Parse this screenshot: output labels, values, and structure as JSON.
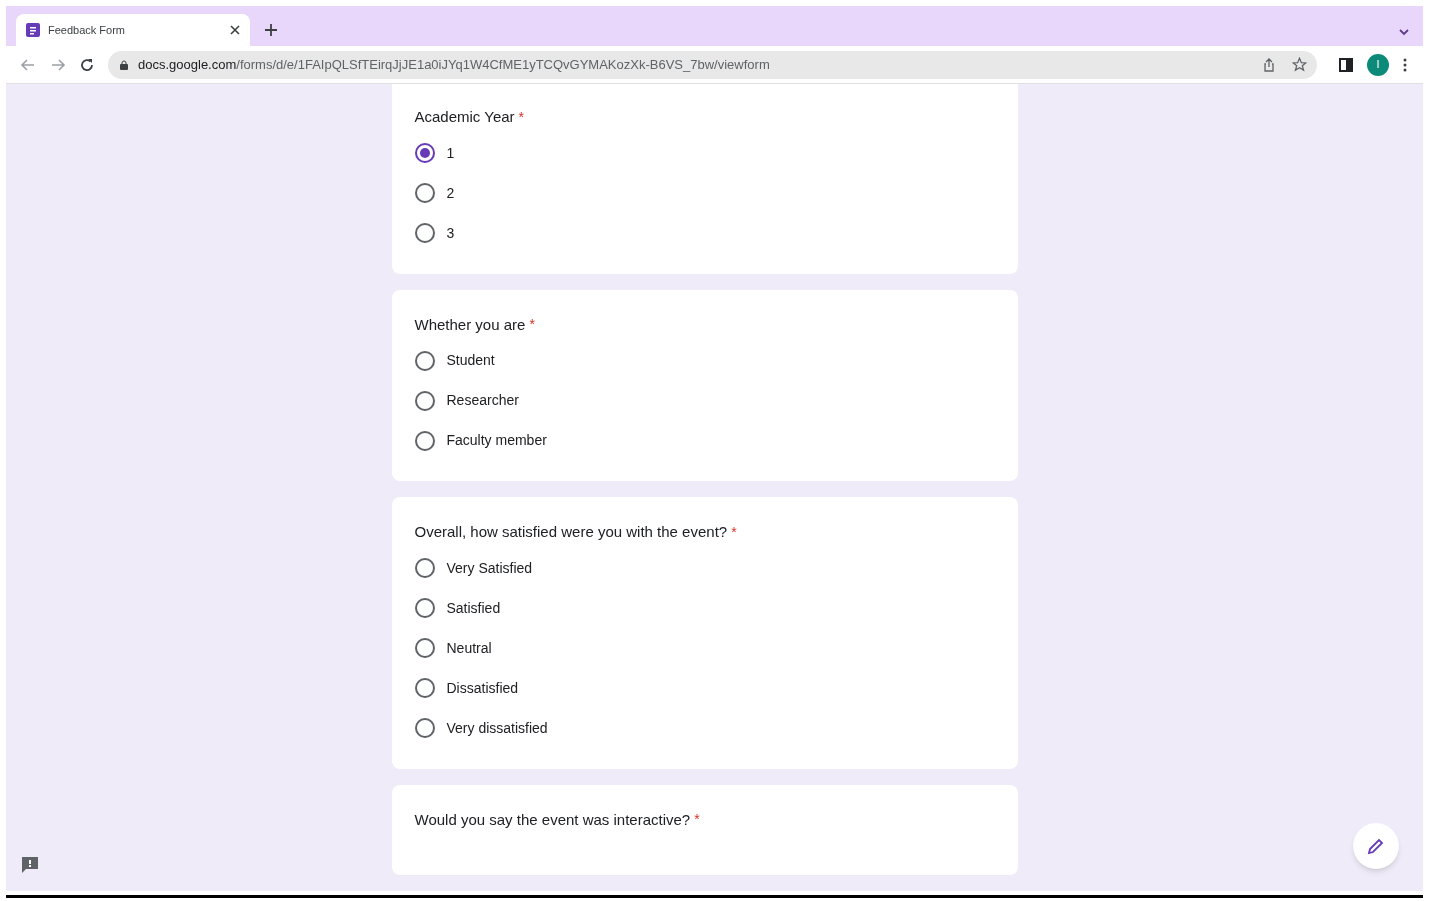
{
  "browser": {
    "tab": {
      "title": "Feedback Form",
      "selected": true
    },
    "url": {
      "domain": "docs.google.com",
      "path": "/forms/d/e/1FAIpQLSfTEirqJjJE1a0iJYq1W4CfME1yTCQvGYMAKozXk-B6VS_7bw/viewform"
    },
    "profile_initial": "I"
  },
  "questions": [
    {
      "title": "Academic Year",
      "required_mark": "*",
      "options": [
        {
          "label": "1",
          "selected": true
        },
        {
          "label": "2",
          "selected": false
        },
        {
          "label": "3",
          "selected": false
        }
      ]
    },
    {
      "title": "Whether you are",
      "required_mark": "*",
      "options": [
        {
          "label": "Student",
          "selected": false
        },
        {
          "label": "Researcher",
          "selected": false
        },
        {
          "label": "Faculty member",
          "selected": false
        }
      ]
    },
    {
      "title": "Overall, how satisfied were you with the event?",
      "required_mark": "*",
      "options": [
        {
          "label": "Very Satisfied",
          "selected": false
        },
        {
          "label": "Satisfied",
          "selected": false
        },
        {
          "label": "Neutral",
          "selected": false
        },
        {
          "label": "Dissatisfied",
          "selected": false
        },
        {
          "label": "Very dissatisfied",
          "selected": false
        }
      ]
    },
    {
      "title": "Would you say the event was interactive?",
      "required_mark": "*"
    }
  ]
}
